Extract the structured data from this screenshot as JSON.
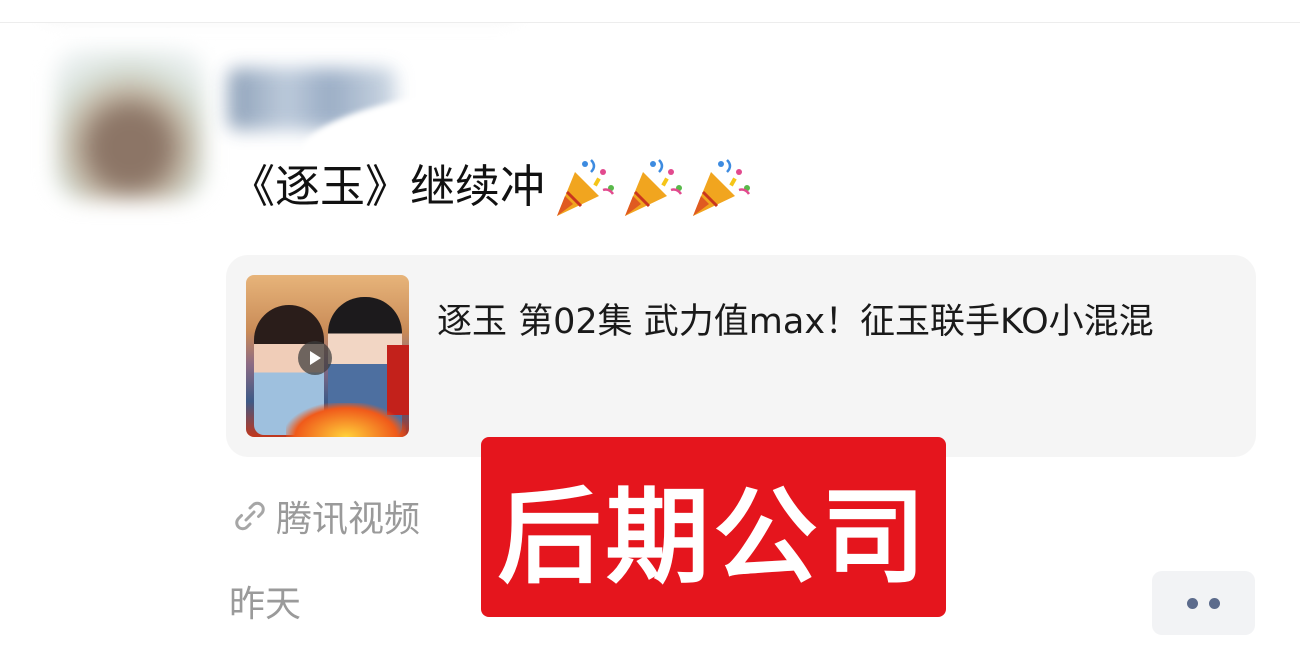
{
  "post": {
    "text": "《逐玉》继续冲",
    "emojis": [
      "party-popper-icon",
      "party-popper-icon",
      "party-popper-icon"
    ],
    "video_card": {
      "title": "逐玉 第02集 武力值max！征玉联手KO小混混",
      "thumbnail": "drama-thumbnail",
      "play_icon": "play-icon"
    },
    "source": {
      "icon": "link-icon",
      "label": "腾讯视频"
    },
    "time": "昨天",
    "more_icon": "more-dots-icon"
  },
  "watermark": {
    "text": "后期公司",
    "color": "#e5151d"
  },
  "colors": {
    "text_primary": "#111111",
    "text_secondary": "#9a9a9a",
    "card_bg": "#f5f5f5",
    "more_dots": "#5c6b8c"
  }
}
